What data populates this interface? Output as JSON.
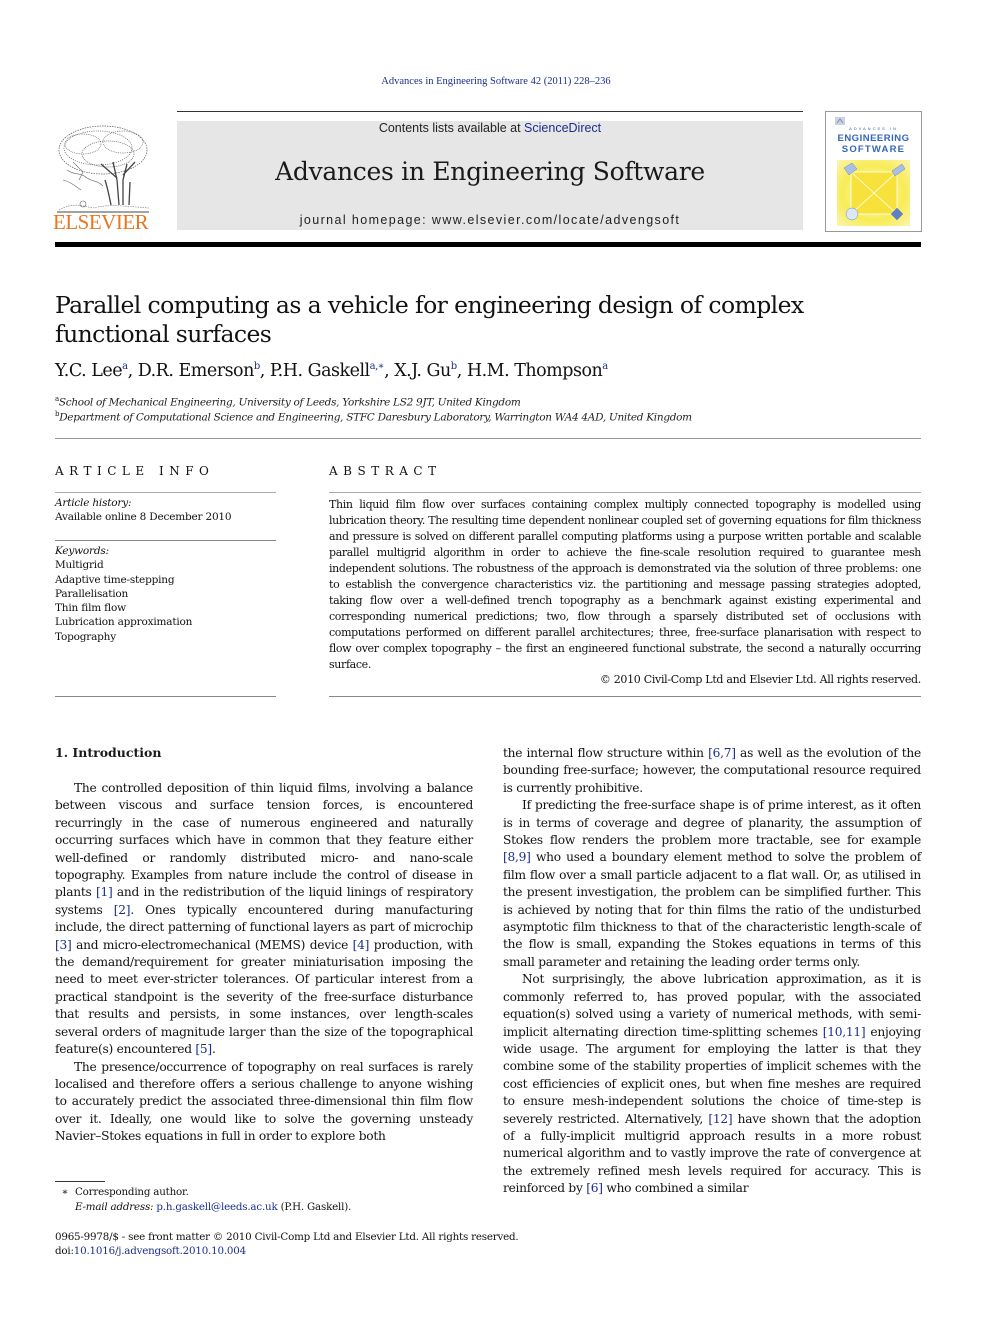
{
  "running_head": "Advances in Engineering Software 42 (2011) 228–236",
  "masthead": {
    "contents_prefix": "Contents lists available at ",
    "contents_link": "ScienceDirect",
    "journal_name": "Advances in Engineering Software",
    "homepage": "journal homepage: www.elsevier.com/locate/advengsoft",
    "publisher_logo_text": "ELSEVIER",
    "cover": {
      "small_line": "ADVANCES IN",
      "title_line1": "ENGINEERING",
      "title_line2": "SOFTWARE"
    }
  },
  "colors": {
    "link": "#1b2f8a",
    "elsevier_orange": "#e87722",
    "masthead_gray": "#e6e6e6",
    "cover_blue": "#3366bb",
    "cover_yellow": "#f7e640"
  },
  "article": {
    "title": "Parallel computing as a vehicle for engineering design of complex functional surfaces",
    "authors": [
      {
        "name": "Y.C. Lee",
        "aff": "a"
      },
      {
        "name": "D.R. Emerson",
        "aff": "b"
      },
      {
        "name": "P.H. Gaskell",
        "aff": "a,∗"
      },
      {
        "name": "X.J. Gu",
        "aff": "b"
      },
      {
        "name": "H.M. Thompson",
        "aff": "a"
      }
    ],
    "affiliations": [
      {
        "mark": "a",
        "text": "School of Mechanical Engineering, University of Leeds, Yorkshire LS2 9JT, United Kingdom"
      },
      {
        "mark": "b",
        "text": "Department of Computational Science and Engineering, STFC Daresbury Laboratory, Warrington WA4 4AD, United Kingdom"
      }
    ]
  },
  "article_info": {
    "heading": "ARTICLE INFO",
    "history_label": "Article history:",
    "history_value": "Available online 8 December 2010",
    "keywords_label": "Keywords:",
    "keywords": [
      "Multigrid",
      "Adaptive time-stepping",
      "Parallelisation",
      "Thin film flow",
      "Lubrication approximation",
      "Topography"
    ]
  },
  "abstract": {
    "heading": "ABSTRACT",
    "text": "Thin liquid film flow over surfaces containing complex multiply connected topography is modelled using lubrication theory. The resulting time dependent nonlinear coupled set of governing equations for film thickness and pressure is solved on different parallel computing platforms using a purpose written portable and scalable parallel multigrid algorithm in order to achieve the fine-scale resolution required to guarantee mesh independent solutions. The robustness of the approach is demonstrated via the solution of three problems: one to establish the convergence characteristics viz. the partitioning and message passing strategies adopted, taking flow over a well-defined trench topography as a benchmark against existing experimental and corresponding numerical predictions; two, flow through a sparsely distributed set of occlusions with computations performed on different parallel architectures; three, free-surface planarisation with respect to flow over complex topography – the first an engineered functional substrate, the second a naturally occurring surface.",
    "copyright": "© 2010 Civil-Comp Ltd and Elsevier Ltd. All rights reserved."
  },
  "body": {
    "section_heading": "1. Introduction",
    "paragraphs": [
      {
        "column": "left",
        "segments": [
          {
            "t": "The controlled deposition of thin liquid films, involving a balance between viscous and surface tension forces, is encountered recurringly in the case of numerous engineered and naturally occurring surfaces which have in common that they feature either well-defined or randomly distributed micro- and nano-scale topography. Examples from nature include the control of disease in plants "
          },
          {
            "ref": "[1]"
          },
          {
            "t": " and in the redistribution of the liquid linings of respiratory systems "
          },
          {
            "ref": "[2]"
          },
          {
            "t": ". Ones typically encountered during manufacturing include, the direct patterning of functional layers as part of microchip "
          },
          {
            "ref": "[3]"
          },
          {
            "t": " and micro-electromechanical (MEMS) device "
          },
          {
            "ref": "[4]"
          },
          {
            "t": " production, with the demand/requirement for greater miniaturisation imposing the need to meet ever-stricter tolerances. Of particular interest from a practical standpoint is the severity of the free-surface disturbance that results and persists, in some instances, over length-scales several orders of magnitude larger than the size of the topographical feature(s) encountered "
          },
          {
            "ref": "[5]"
          },
          {
            "t": "."
          }
        ]
      },
      {
        "column": "left",
        "segments": [
          {
            "t": "The presence/occurrence of topography on real surfaces is rarely localised and therefore offers a serious challenge to anyone wishing to accurately predict the associated three-dimensional thin film flow over it. Ideally, one would like to solve the governing unsteady Navier–Stokes equations in full in order to explore both"
          }
        ]
      },
      {
        "column": "right",
        "continuation": true,
        "segments": [
          {
            "t": "the internal flow structure within "
          },
          {
            "ref": "[6,7]"
          },
          {
            "t": " as well as the evolution of the bounding free-surface; however, the computational resource required is currently prohibitive."
          }
        ]
      },
      {
        "column": "right",
        "segments": [
          {
            "t": "If predicting the free-surface shape is of prime interest, as it often is in terms of coverage and degree of planarity, the assumption of Stokes flow renders the problem more tractable, see for example "
          },
          {
            "ref": "[8,9]"
          },
          {
            "t": " who used a boundary element method to solve the problem of film flow over a small particle adjacent to a flat wall. Or, as utilised in the present investigation, the problem can be simplified further. This is achieved by noting that for thin films the ratio of the undisturbed asymptotic film thickness to that of the characteristic length-scale of the flow is small, expanding the Stokes equations in terms of this small parameter and retaining the leading order terms only."
          }
        ]
      },
      {
        "column": "right",
        "segments": [
          {
            "t": "Not surprisingly, the above lubrication approximation, as it is commonly referred to, has proved popular, with the associated equation(s) solved using a variety of numerical methods, with semi-implicit alternating direction time-splitting schemes "
          },
          {
            "ref": "[10,11]"
          },
          {
            "t": " enjoying wide usage. The argument for employing the latter is that they combine some of the stability properties of implicit schemes with the cost efficiencies of explicit ones, but when fine meshes are required to ensure mesh-independent solutions the choice of time-step is severely restricted. Alternatively, "
          },
          {
            "ref": "[12]"
          },
          {
            "t": " have shown that the adoption of a fully-implicit multigrid approach results in a more robust numerical algorithm and to vastly improve the rate of convergence at the extremely refined mesh levels required for accuracy. This is reinforced by "
          },
          {
            "ref": "[6]"
          },
          {
            "t": " who combined a similar"
          }
        ]
      }
    ]
  },
  "footnotes": {
    "corresponding_mark": "∗",
    "corresponding_text": "Corresponding author.",
    "email_label": "E-mail address:",
    "email": "p.h.gaskell@leeds.ac.uk",
    "email_suffix": " (P.H. Gaskell).",
    "front_matter": "0965-9978/$ - see front matter © 2010 Civil-Comp Ltd and Elsevier Ltd. All rights reserved.",
    "doi_prefix": "doi:",
    "doi": "10.1016/j.advengsoft.2010.10.004"
  }
}
